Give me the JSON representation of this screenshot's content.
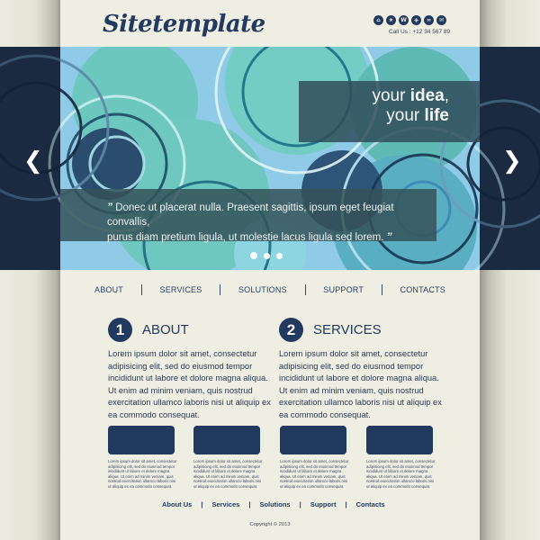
{
  "header": {
    "logo": "Sitetemplate",
    "social_icons": [
      "home-icon",
      "star-icon",
      "w-icon",
      "share-icon",
      "link-icon",
      "mail-icon"
    ],
    "social_glyphs": [
      "⌂",
      "★",
      "W",
      "◈",
      "∞",
      "✉"
    ],
    "call_us": "Call Us : +12 34 567 89"
  },
  "hero": {
    "headline_line1_regular": "your ",
    "headline_line1_bold": "idea",
    "headline_line1_comma": ",",
    "headline_line2_regular": "your ",
    "headline_line2_bold": "life",
    "quote_open": "”",
    "quote_line1": "Donec ut placerat nulla. Praesent sagittis, ipsum eget feugiat convallis,",
    "quote_line2": "purus diam pretium ligula, ut molestie lacus ligula sed lorem.",
    "quote_close": "”",
    "prev_arrow": "❮",
    "next_arrow": "❯",
    "slides": 3,
    "active_slide": 1
  },
  "nav": {
    "items": [
      "ABOUT",
      "SERVICES",
      "SOLUTIONS",
      "SUPPORT",
      "CONTACTS"
    ]
  },
  "columns": [
    {
      "number": "1",
      "title": "ABOUT",
      "text": "Lorem ipsum dolor sit amet, consectetur adipisicing elit, sed do eiusmod tempor incididunt ut labore et dolore magna aliqua. Ut enim ad minim veniam, quis nostrud exercitation ullamco laboris nisi ut aliquip ex ea commodo consequat."
    },
    {
      "number": "2",
      "title": "SERVICES",
      "text": "Lorem ipsum dolor sit amet, consectetur adipisicing elit, sed do eiusmod tempor incididunt ut labore et dolore magna aliqua. Ut enim ad minim veniam, quis nostrud exercitation ullamco laboris nisi ut aliquip ex ea commodo consequat."
    }
  ],
  "cards": [
    {
      "text": "Lorem ipsum dolor sit amet, consectetur adipisicing elit, sed do eiusmod tempor incididunt ut labore et dolore magna aliqua. Ut enim ad minim veniam, quis nostrud exercitation ullamco laboris nisi ut aliquip ex ea commodo consequat."
    },
    {
      "text": "Lorem ipsum dolor sit amet, consectetur adipisicing elit, sed do eiusmod tempor incididunt ut labore et dolore magna aliqua. Ut enim ad minim veniam, quis nostrud exercitation ullamco laboris nisi ut aliquip ex ea commodo consequat."
    },
    {
      "text": "Lorem ipsum dolor sit amet, consectetur adipisicing elit, sed do eiusmod tempor incididunt ut labore et dolore magna aliqua. Ut enim ad minim veniam, quis nostrud exercitation ullamco laboris nisi ut aliquip ex ea commodo consequat."
    },
    {
      "text": "Lorem ipsum dolor sit amet, consectetur adipisicing elit, sed do eiusmod tempor incididunt ut labore et dolore magna aliqua. Ut enim ad minim veniam, quis nostrud exercitation ullamco laboris nisi ut aliquip ex ea commodo consequat."
    }
  ],
  "footer": {
    "links": [
      "About Us",
      "Services",
      "Solutions",
      "Support",
      "Contacts"
    ],
    "separator": "|",
    "copyright": "Copyright © 2013"
  },
  "colors": {
    "brand_navy": "#233a60",
    "page_bg": "#eeeee2",
    "hero_dark": "#1d2d44",
    "hero_teal": "#6cc7bf",
    "hero_sky": "#8ec9e6"
  }
}
